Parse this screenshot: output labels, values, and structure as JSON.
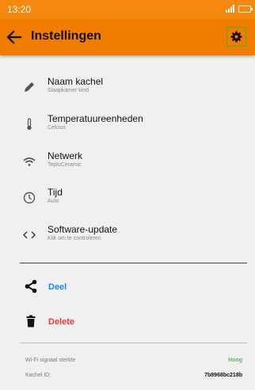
{
  "status_bar": {
    "time": "13:20"
  },
  "header": {
    "title": "Instellingen",
    "back_icon": "arrow-left-icon",
    "settings_icon": "gear-icon"
  },
  "settings": [
    {
      "title": "Naam kachel",
      "subtitle": "Slaapkamer kind",
      "icon": "pencil-icon"
    },
    {
      "title": "Temperatuureenheden",
      "subtitle": "Celcius",
      "icon": "thermometer-icon"
    },
    {
      "title": "Netwerk",
      "subtitle": "TeploCeramic",
      "icon": "wifi-icon"
    },
    {
      "title": "Tijd",
      "subtitle": "Auto",
      "icon": "clock-icon"
    },
    {
      "title": "Software-update",
      "subtitle": "Klik om te controleren",
      "icon": "code-icon"
    }
  ],
  "actions": {
    "share_label": "Deel",
    "share_color": "#1e88e5",
    "delete_label": "Delete",
    "delete_color": "#e53935"
  },
  "info": {
    "wifi_label": "Wi-Fi signaal sterkte",
    "wifi_value": "Hoog",
    "wifi_value_color": "#5cb85c",
    "device_label": "Kachel ID:",
    "device_value": "7b8968bc218b"
  },
  "colors": {
    "statusbar": "#f5880e",
    "appbar": "#f07d00",
    "background": "#f0f0f0"
  }
}
